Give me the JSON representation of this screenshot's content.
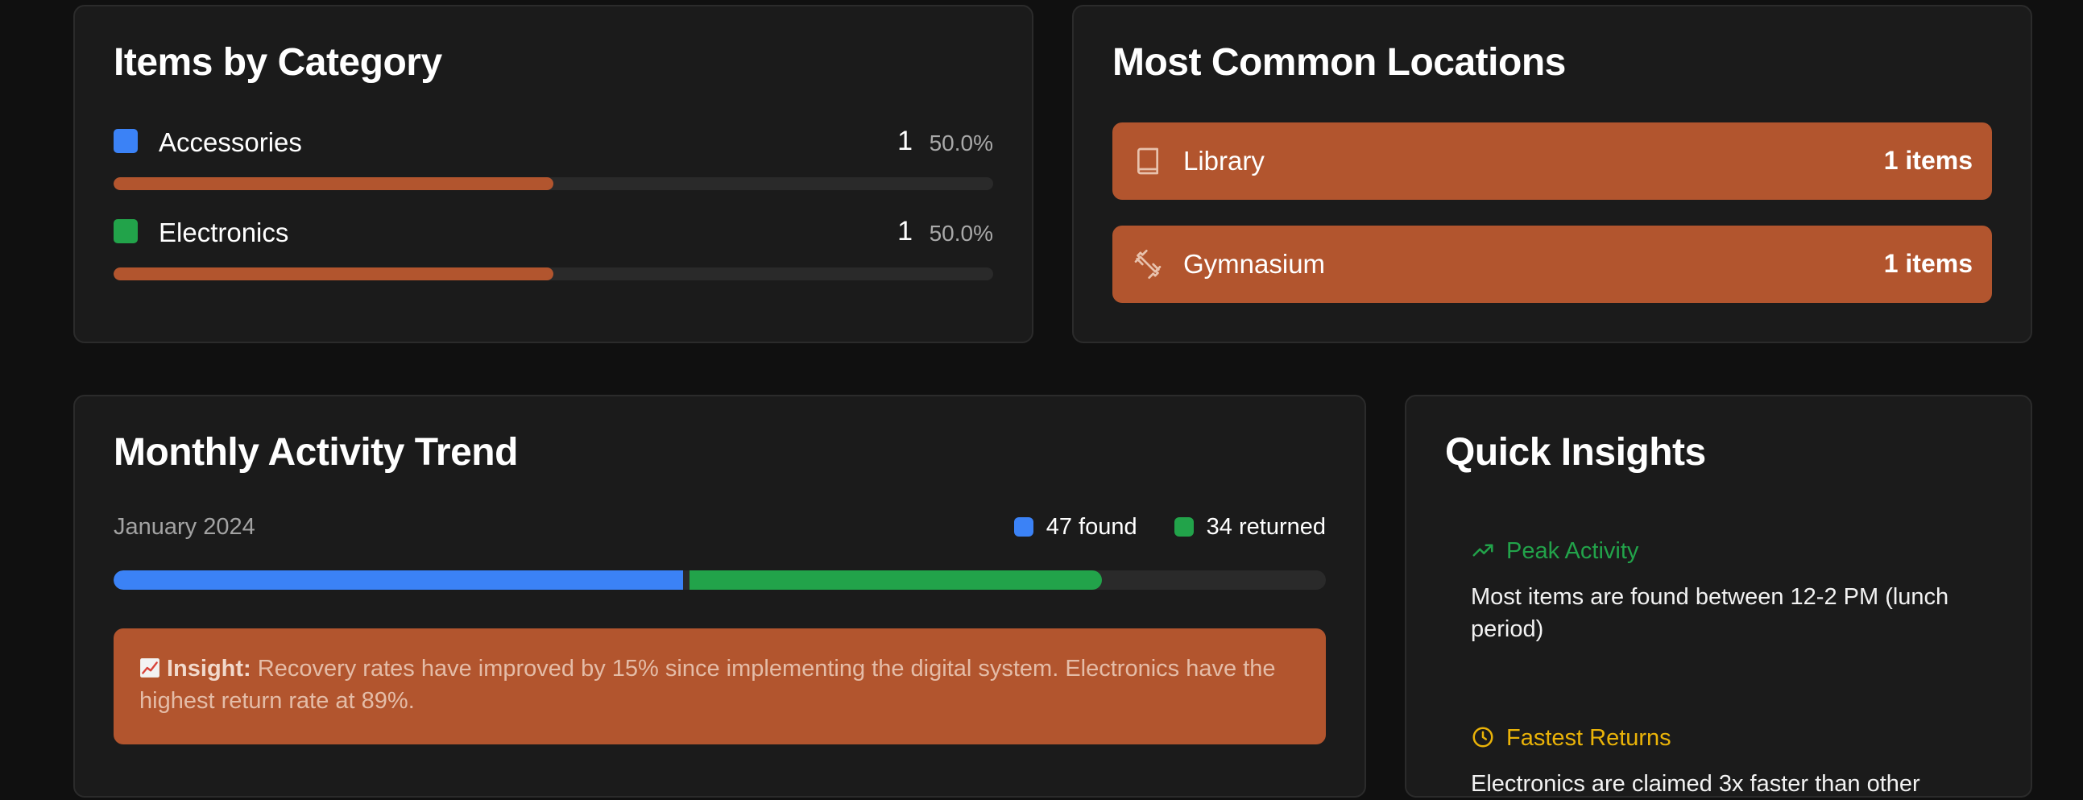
{
  "colors": {
    "accent": "#b2552e",
    "blue": "#3b82f6",
    "green": "#22a34a",
    "yellow": "#eab308",
    "card": "#1b1b1b",
    "background": "#101010"
  },
  "category_card": {
    "title": "Items by Category",
    "items": [
      {
        "label": "Accessories",
        "count": "1",
        "percent": "50.0%",
        "share": 0.5,
        "swatch": "#3b82f6"
      },
      {
        "label": "Electronics",
        "count": "1",
        "percent": "50.0%",
        "share": 0.5,
        "swatch": "#22a34a"
      }
    ]
  },
  "locations_card": {
    "title": "Most Common Locations",
    "items": [
      {
        "label": "Library",
        "count": "1 items",
        "icon": "book-icon"
      },
      {
        "label": "Gymnasium",
        "count": "1 items",
        "icon": "dumbbell-icon"
      }
    ]
  },
  "monthly_card": {
    "title": "Monthly Activity Trend",
    "month": "January 2024",
    "legend_found": "47 found",
    "legend_returned": "34 returned",
    "found_value": 47,
    "returned_value": 34,
    "insight_label": "Insight:",
    "insight_text": "Recovery rates have improved by 15% since implementing the digital system. Electronics have the highest return rate at 89%.",
    "insight_icon": "chart-increasing-icon"
  },
  "quick_insights": {
    "title": "Quick Insights",
    "items": [
      {
        "heading": "Peak Activity",
        "text": "Most items are found between 12-2 PM (lunch period)",
        "icon": "trending-up-icon",
        "color": "#22a34a"
      },
      {
        "heading": "Fastest Returns",
        "text": "Electronics are claimed 3x faster than other",
        "icon": "clock-icon",
        "color": "#eab308"
      }
    ]
  }
}
